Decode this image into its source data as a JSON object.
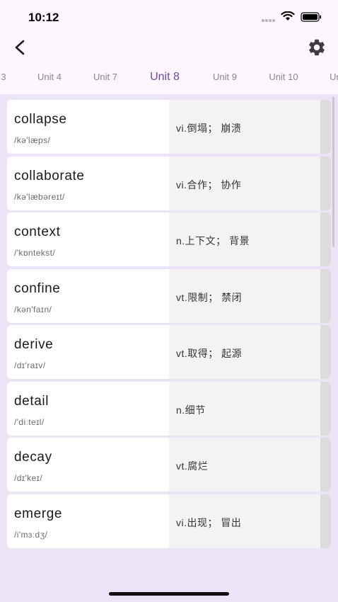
{
  "status_bar": {
    "time": "10:12"
  },
  "tabs": [
    {
      "label": "3"
    },
    {
      "label": "Unit 4"
    },
    {
      "label": "Unit 7"
    },
    {
      "label": "Unit 8"
    },
    {
      "label": "Unit 9"
    },
    {
      "label": "Unit 10"
    },
    {
      "label": "Ur"
    }
  ],
  "active_tab": "Unit 8",
  "words": [
    {
      "word": "collapse",
      "phonetic": "/kə'læps/",
      "meaning": "vi.倒塌； 崩溃"
    },
    {
      "word": "collaborate",
      "phonetic": "/kə'læbəreɪt/",
      "meaning": "vi.合作； 协作"
    },
    {
      "word": "context",
      "phonetic": "/'kɒntekst/",
      "meaning": "n.上下文； 背景"
    },
    {
      "word": "confine",
      "phonetic": "/kən'faɪn/",
      "meaning": "vt.限制； 禁闭"
    },
    {
      "word": "derive",
      "phonetic": "/dɪ'raɪv/",
      "meaning": "vt.取得； 起源"
    },
    {
      "word": "detail",
      "phonetic": "/'diːteɪl/",
      "meaning": "n.细节"
    },
    {
      "word": "decay",
      "phonetic": "/dɪ'keɪ/",
      "meaning": "vt.腐烂"
    },
    {
      "word": "emerge",
      "phonetic": "/i'mɜːdʒ/",
      "meaning": "vi.出现； 冒出"
    }
  ],
  "colors": {
    "accent": "#6a4aa6",
    "background": "#ece4f6",
    "header": "#fdf6fd"
  },
  "icons": {
    "back": "chevron-left-icon",
    "settings": "gear-icon"
  }
}
